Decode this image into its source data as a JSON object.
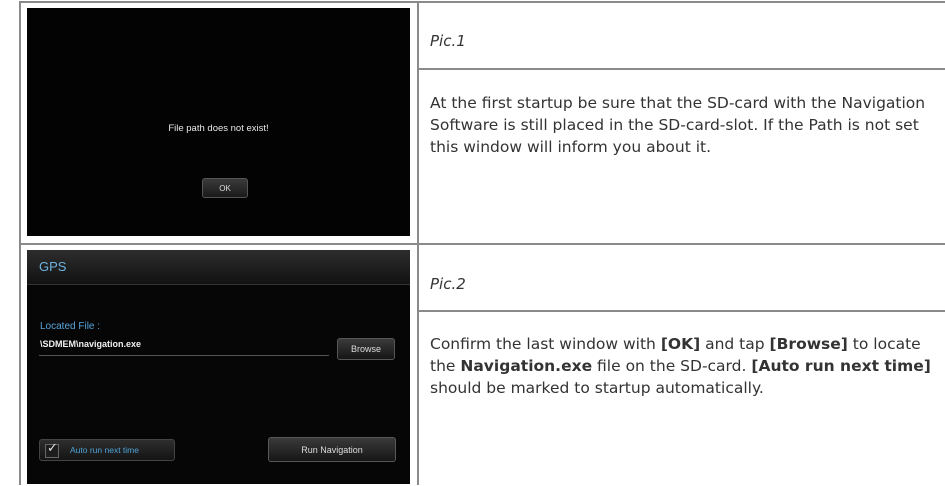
{
  "row1": {
    "screen": {
      "message": "File path does not exist!",
      "ok_label": "OK"
    },
    "caption": "Pic.1",
    "description": "At the first startup be sure that the SD-card with the Navigation Software is still placed in the SD-card-slot. If the Path is not set this window will inform you about it."
  },
  "row2": {
    "screen": {
      "title": "GPS",
      "located_file_label": "Located File :",
      "located_file_value": "\\SDMEM\\navigation.exe",
      "browse_label": "Browse",
      "auto_run_label": "Auto run next time",
      "auto_run_checked": true,
      "run_navigation_label": "Run Navigation",
      "accent_color": "#5aa6dd"
    },
    "caption": "Pic.2",
    "description": {
      "p1": "Confirm the last window with ",
      "ok": "[OK]",
      "p2": " and tap ",
      "browse": "[Browse]",
      "p3": " to locate the ",
      "exe": "Navigation.exe",
      "p4": " file on the SD-card. ",
      "autorun": "[Auto run next time]",
      "p5": " should be marked to startup automatically."
    }
  }
}
